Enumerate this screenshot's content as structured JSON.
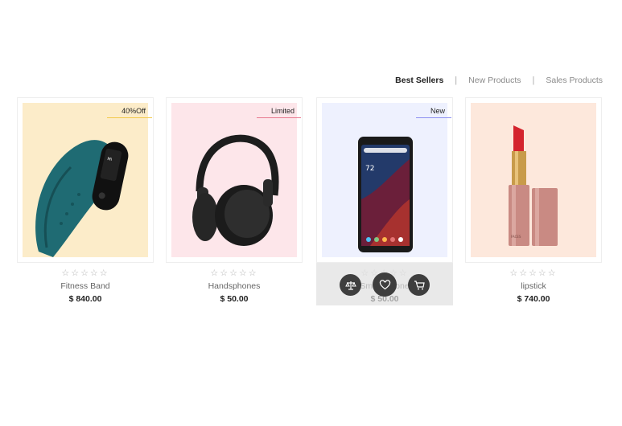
{
  "tabs": [
    {
      "label": "Best Sellers",
      "active": true
    },
    {
      "label": "New Products",
      "active": false
    },
    {
      "label": "Sales Products",
      "active": false
    }
  ],
  "products": [
    {
      "name": "Fitness Band",
      "price": "$ 840.00",
      "badge": "40%Off",
      "bg": "#fcecc9",
      "badge_color": "#f2c94c",
      "rating": 0
    },
    {
      "name": "Handsphones",
      "price": "$ 50.00",
      "badge": "Limited",
      "bg": "#fde6ea",
      "badge_color": "#e8798f",
      "rating": 0
    },
    {
      "name": "Smart Phone",
      "price": "$ 50.00",
      "badge": "New",
      "bg": "#eef1fe",
      "badge_color": "#8c8ff0",
      "rating": 0
    },
    {
      "name": "lipstick",
      "price": "$ 740.00",
      "badge": "",
      "bg": "#fde8dc",
      "badge_color": "",
      "rating": 0
    }
  ],
  "icons": {
    "compare": "balance-scale-icon",
    "wishlist": "heart-icon",
    "cart": "shopping-cart-icon"
  },
  "stars_text": "☆☆☆☆☆"
}
